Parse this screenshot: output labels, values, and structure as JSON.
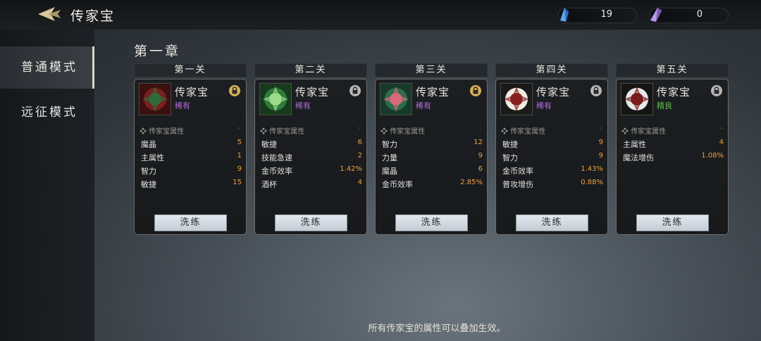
{
  "header": {
    "title": "传家宝",
    "currency_blue": "19",
    "currency_purple": "0"
  },
  "sidebar": {
    "items": [
      {
        "label": "普通模式"
      },
      {
        "label": "远征模式"
      }
    ]
  },
  "chapter": "第一章",
  "attr_header": "传家宝属性",
  "reroll_label": "洗练",
  "footer": "所有传家宝的属性可以叠加生效。",
  "colors": {
    "rare": "#b06ad8",
    "fine": "#5fbf4a",
    "value": "#e9a23a"
  },
  "cards": [
    {
      "stage": "第一关",
      "name": "传家宝",
      "rarity": "稀有",
      "lock": "gold",
      "attrs": [
        {
          "k": "魔晶",
          "v": "5"
        },
        {
          "k": "主属性",
          "v": "1"
        },
        {
          "k": "智力",
          "v": "9"
        },
        {
          "k": "敏捷",
          "v": "15"
        }
      ]
    },
    {
      "stage": "第二关",
      "name": "传家宝",
      "rarity": "稀有",
      "lock": "grey",
      "attrs": [
        {
          "k": "敏捷",
          "v": "6"
        },
        {
          "k": "技能急速",
          "v": "2"
        },
        {
          "k": "金币效率",
          "v": "1.42%"
        },
        {
          "k": "酒杯",
          "v": "4"
        }
      ]
    },
    {
      "stage": "第三关",
      "name": "传家宝",
      "rarity": "稀有",
      "lock": "gold",
      "attrs": [
        {
          "k": "智力",
          "v": "12"
        },
        {
          "k": "力量",
          "v": "9"
        },
        {
          "k": "魔晶",
          "v": "6"
        },
        {
          "k": "金币效率",
          "v": "2.85%"
        }
      ]
    },
    {
      "stage": "第四关",
      "name": "传家宝",
      "rarity": "稀有",
      "lock": "grey",
      "attrs": [
        {
          "k": "敏捷",
          "v": "9"
        },
        {
          "k": "智力",
          "v": "9"
        },
        {
          "k": "金币效率",
          "v": "1.43%"
        },
        {
          "k": "普攻增伤",
          "v": "0.88%"
        }
      ]
    },
    {
      "stage": "第五关",
      "name": "传家宝",
      "rarity": "精良",
      "lock": "grey",
      "attrs": [
        {
          "k": "主属性",
          "v": "4"
        },
        {
          "k": "魔法增伤",
          "v": "1.08%"
        }
      ]
    }
  ]
}
